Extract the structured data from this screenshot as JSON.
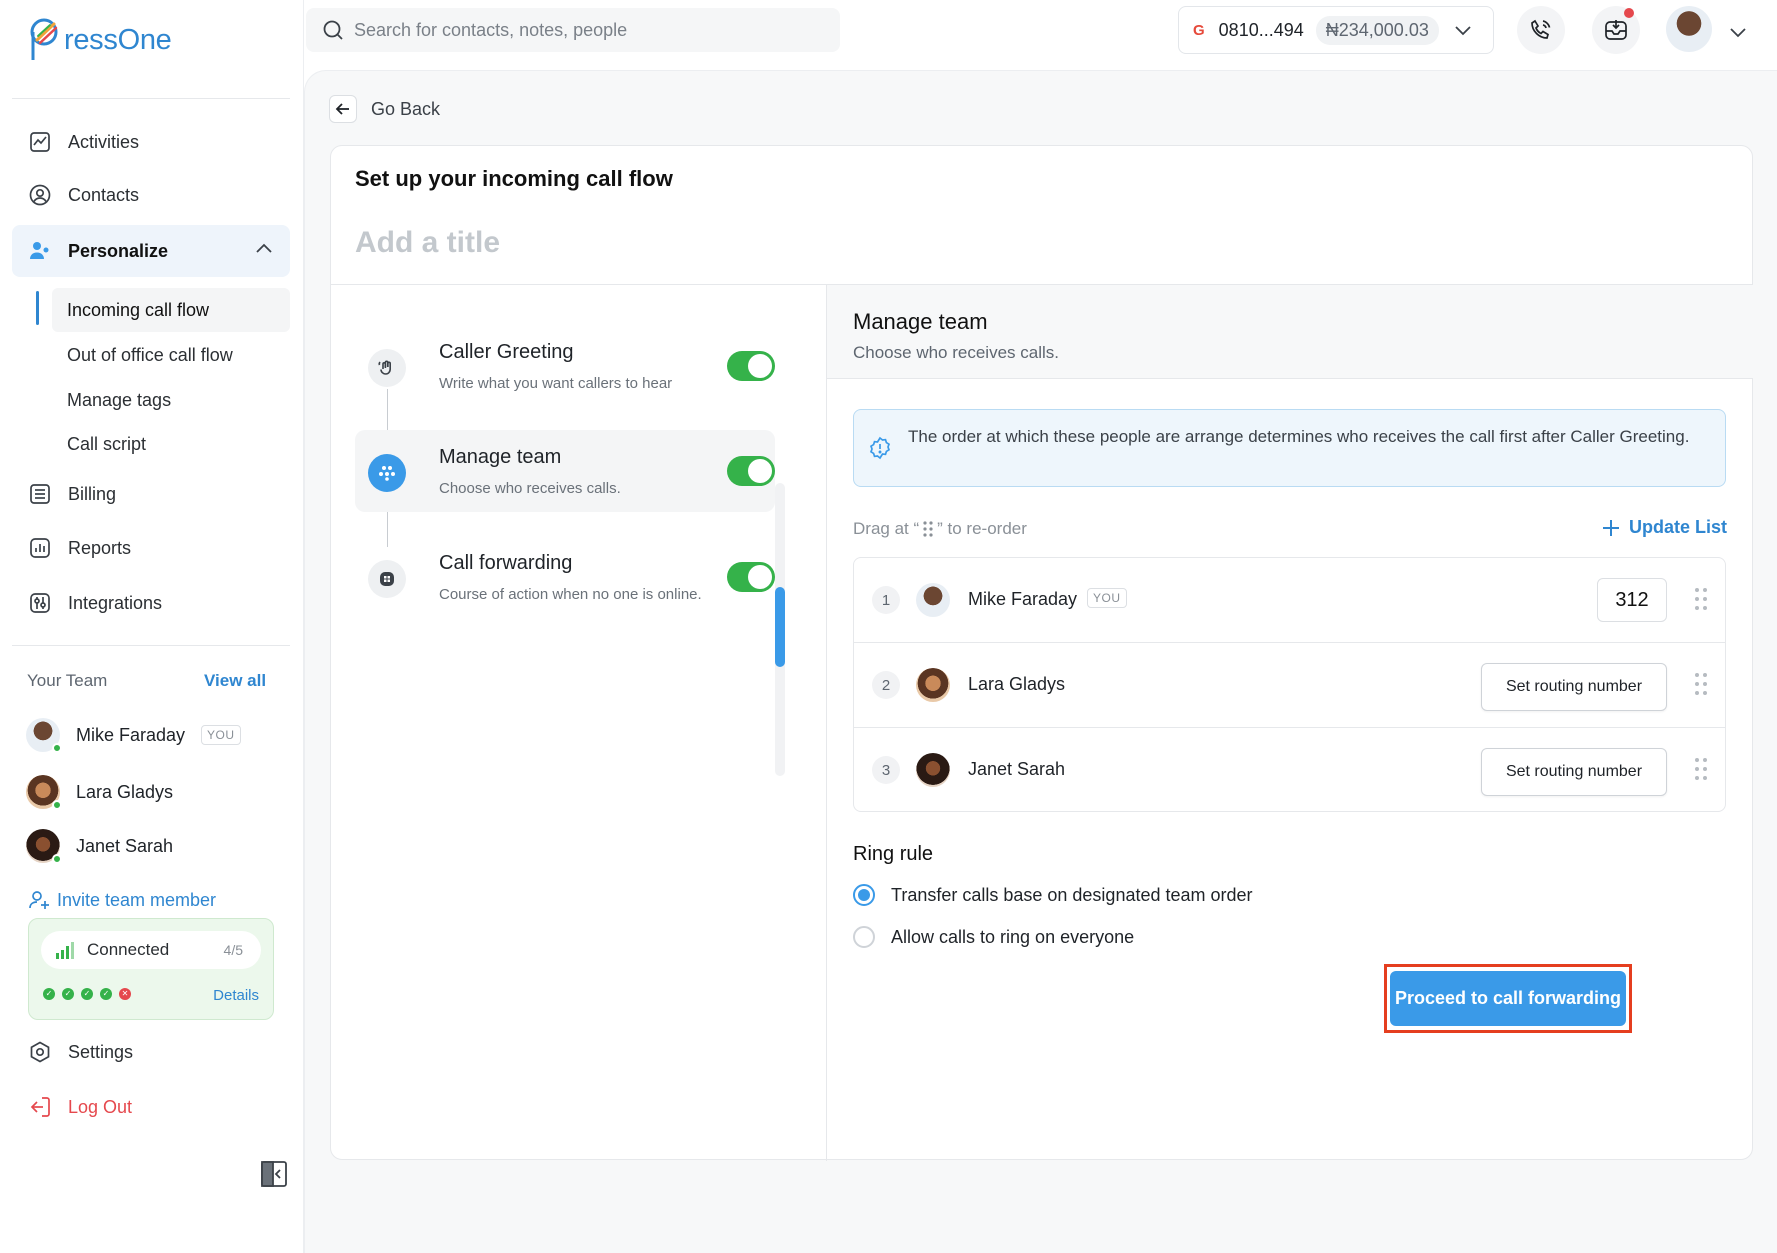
{
  "app": {
    "logo_text": "ressOne"
  },
  "sidebar": {
    "nav": [
      {
        "label": "Activities",
        "icon": "activity-chart-icon"
      },
      {
        "label": "Contacts",
        "icon": "contact-user-icon"
      },
      {
        "label": "Personalize",
        "icon": "personalize-users-icon"
      },
      {
        "label": "Billing",
        "icon": "billing-list-icon"
      },
      {
        "label": "Reports",
        "icon": "reports-chart-icon"
      },
      {
        "label": "Integrations",
        "icon": "integrations-sliders-icon"
      }
    ],
    "personalize_sub": [
      {
        "label": "Incoming call flow",
        "active": true
      },
      {
        "label": "Out of office call flow"
      },
      {
        "label": "Manage tags"
      },
      {
        "label": "Call script"
      }
    ],
    "team": {
      "heading": "Your Team",
      "view_all": "View all",
      "you_tag": "YOU",
      "members": [
        {
          "name": "Mike Faraday",
          "you": true,
          "online": true
        },
        {
          "name": "Lara Gladys",
          "online": true
        },
        {
          "name": "Janet Sarah",
          "online": true
        }
      ],
      "invite": "Invite team member"
    },
    "connection": {
      "label": "Connected",
      "count": "4/5",
      "details": "Details",
      "statuses": [
        "ok",
        "ok",
        "ok",
        "ok",
        "error"
      ]
    },
    "settings": "Settings",
    "logout": "Log Out"
  },
  "topbar": {
    "search_placeholder": "Search for contacts, notes, people",
    "wallet": {
      "provider": "G",
      "number": "0810...494",
      "balance": "₦234,000.03"
    }
  },
  "main": {
    "go_back": "Go Back",
    "card_title": "Set up your incoming call flow",
    "title_placeholder": "Add a title",
    "steps": [
      {
        "title": "Caller Greeting",
        "desc": "Write what you want callers to hear",
        "enabled": true
      },
      {
        "title": "Manage team",
        "desc": "Choose who receives calls.",
        "enabled": true,
        "active": true
      },
      {
        "title": "Call forwarding",
        "desc": "Course of action when no one is online.",
        "enabled": true
      }
    ],
    "manage_team": {
      "title": "Manage team",
      "desc": "Choose who receives calls.",
      "info": "The order at which these people are arrange determines who receives the call first after Caller Greeting.",
      "drag_prefix": "Drag at “",
      "drag_suffix": "” to re-order",
      "update_list": "Update List",
      "rows": [
        {
          "index": "1",
          "name": "Mike Faraday",
          "you": "YOU",
          "ext": "312"
        },
        {
          "index": "2",
          "name": "Lara Gladys",
          "action": "Set routing number"
        },
        {
          "index": "3",
          "name": "Janet Sarah",
          "action": "Set routing number"
        }
      ],
      "ring_rule": {
        "title": "Ring rule",
        "options": [
          {
            "label": "Transfer calls base on designated team order",
            "selected": true
          },
          {
            "label": "Allow calls to ring on everyone",
            "selected": false
          }
        ]
      },
      "proceed": "Proceed to call forwarding"
    }
  },
  "colors": {
    "accent": "#3a9ae8",
    "brand": "#2f86d0",
    "success": "#35b24a",
    "danger": "#e5484d",
    "highlight": "#e53e1f"
  }
}
